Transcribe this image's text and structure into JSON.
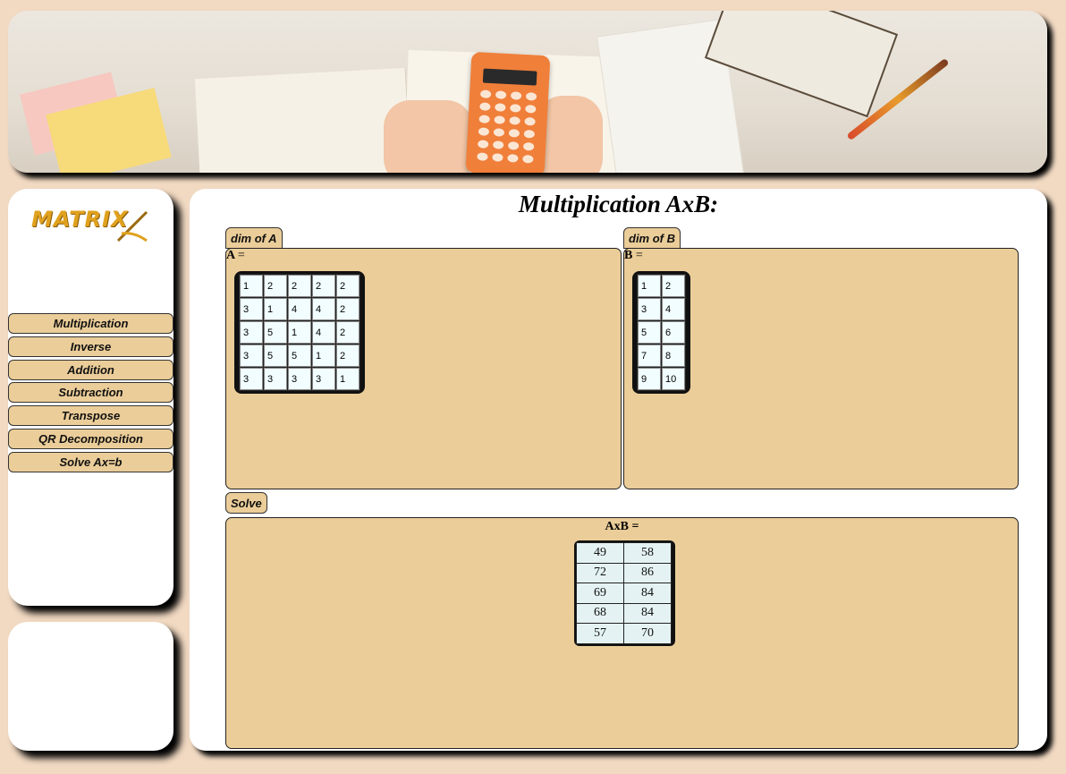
{
  "sidebar": {
    "logo_text": "MATRIX",
    "items": [
      {
        "label": "Multiplication"
      },
      {
        "label": "Inverse"
      },
      {
        "label": "Addition"
      },
      {
        "label": "Subtraction"
      },
      {
        "label": "Transpose"
      },
      {
        "label": "QR Decomposition"
      },
      {
        "label": "Solve Ax=b"
      }
    ]
  },
  "main": {
    "title": "Multiplication AxB:",
    "dim_a_label": "dim of A",
    "dim_b_label": "dim of B",
    "matrix_a_label": "A",
    "matrix_b_label": "B",
    "equals": "=",
    "solve_label": "Solve",
    "result_label": "AxB ="
  },
  "matrix_a": [
    [
      "1",
      "2",
      "2",
      "2",
      "2"
    ],
    [
      "3",
      "1",
      "4",
      "4",
      "2"
    ],
    [
      "3",
      "5",
      "1",
      "4",
      "2"
    ],
    [
      "3",
      "5",
      "5",
      "1",
      "2"
    ],
    [
      "3",
      "3",
      "3",
      "3",
      "1"
    ]
  ],
  "matrix_b": [
    [
      "1",
      "2"
    ],
    [
      "3",
      "4"
    ],
    [
      "5",
      "6"
    ],
    [
      "7",
      "8"
    ],
    [
      "9",
      "10"
    ]
  ],
  "result": [
    [
      "49",
      "58"
    ],
    [
      "72",
      "86"
    ],
    [
      "69",
      "84"
    ],
    [
      "68",
      "84"
    ],
    [
      "57",
      "70"
    ]
  ],
  "colors": {
    "page_bg": "#f1d9c2",
    "accent": "#ebcd99",
    "cell_bg": "#f1fdff",
    "logo": "#e0a21e"
  }
}
